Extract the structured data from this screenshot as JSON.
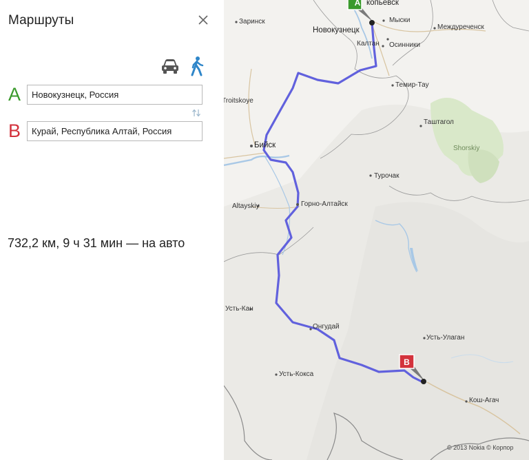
{
  "panel": {
    "title": "Маршруты",
    "close_icon": "close-icon",
    "modes": [
      {
        "name": "car",
        "icon": "car-icon",
        "color": "#555555"
      },
      {
        "name": "walk",
        "icon": "walking-person-icon",
        "color": "#2f86c9"
      }
    ],
    "waypoints": [
      {
        "letter": "A",
        "value": "Новокузнецк, Россия",
        "color": "#3a9a2c"
      },
      {
        "letter": "B",
        "value": "Курай, Республика Алтай, Россия",
        "color": "#d3323c"
      }
    ],
    "swap_icon": "swap-icon",
    "summary": "732,2 км, 9 ч 31 мин — на авто"
  },
  "map": {
    "route_color": "#6161dd",
    "water_color": "#a8c8e6",
    "forest_color": "#d9e8c9",
    "cities": {
      "novokuznetsk": "Новокузнецк",
      "prokopyevsk": "копьевск",
      "myski": "Мыски",
      "mezhdurechensk": "Междуреченск",
      "zarinsk": "Заринск",
      "kaltan": "Калтан",
      "osinniki": "Осинники",
      "temirtau": "Темир-Тау",
      "troitskoye": "Troitskoye",
      "tashtagol": "Таштагол",
      "biysk": "Бийск",
      "shorskiy": "Shorskiy",
      "turochak": "Турочак",
      "altayskiy": "Altayskiy",
      "gorno_altaysk": "Горно-Алтайск",
      "ust_kan": "Усть-Кан",
      "ongudai": "Онгудай",
      "ust_ulagan": "Усть-Улаган",
      "ust_koksa": "Усть-Кокса",
      "kosh_agach": "Кош-Агач"
    },
    "markers": [
      {
        "letter": "A",
        "color": "#3a9a2c"
      },
      {
        "letter": "B",
        "color": "#d3323c"
      }
    ],
    "copyright": "© 2013 Nokia   © Корпор"
  }
}
